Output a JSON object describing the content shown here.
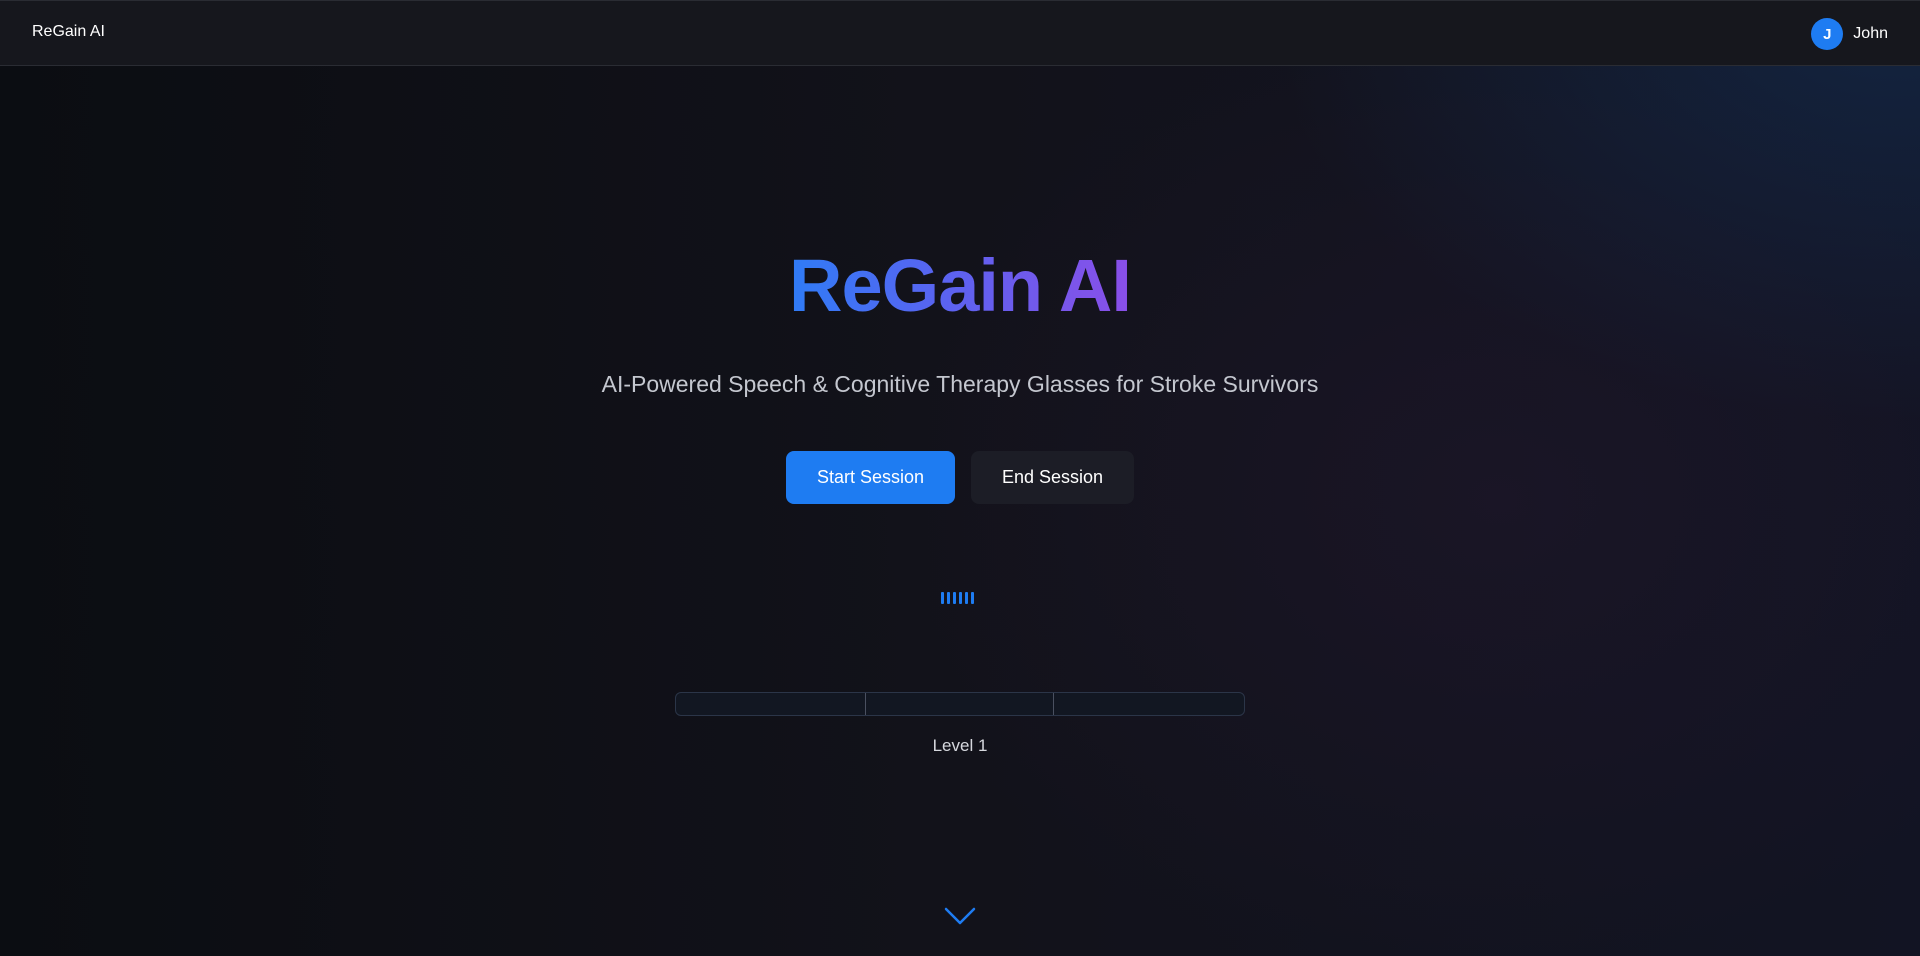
{
  "header": {
    "brand": "ReGain AI",
    "user": {
      "initial": "J",
      "name": "John"
    }
  },
  "hero": {
    "title": "ReGain AI",
    "subtitle": "AI-Powered Speech & Cognitive Therapy Glasses for Stroke Survivors"
  },
  "actions": {
    "start_label": "Start Session",
    "end_label": "End Session"
  },
  "audio_indicator": {
    "bars": 6,
    "state": "idle"
  },
  "progress": {
    "segments": 3,
    "filled_fraction": 0.0,
    "level_label": "Level 1"
  },
  "icons": {
    "audio": "audio-wave-icon",
    "scroll": "chevron-down-icon"
  },
  "colors": {
    "accent": "#1e7cf2",
    "gradient_start": "#2f7cf6",
    "gradient_end": "#8a4fe8",
    "background": "#0b0d12"
  }
}
